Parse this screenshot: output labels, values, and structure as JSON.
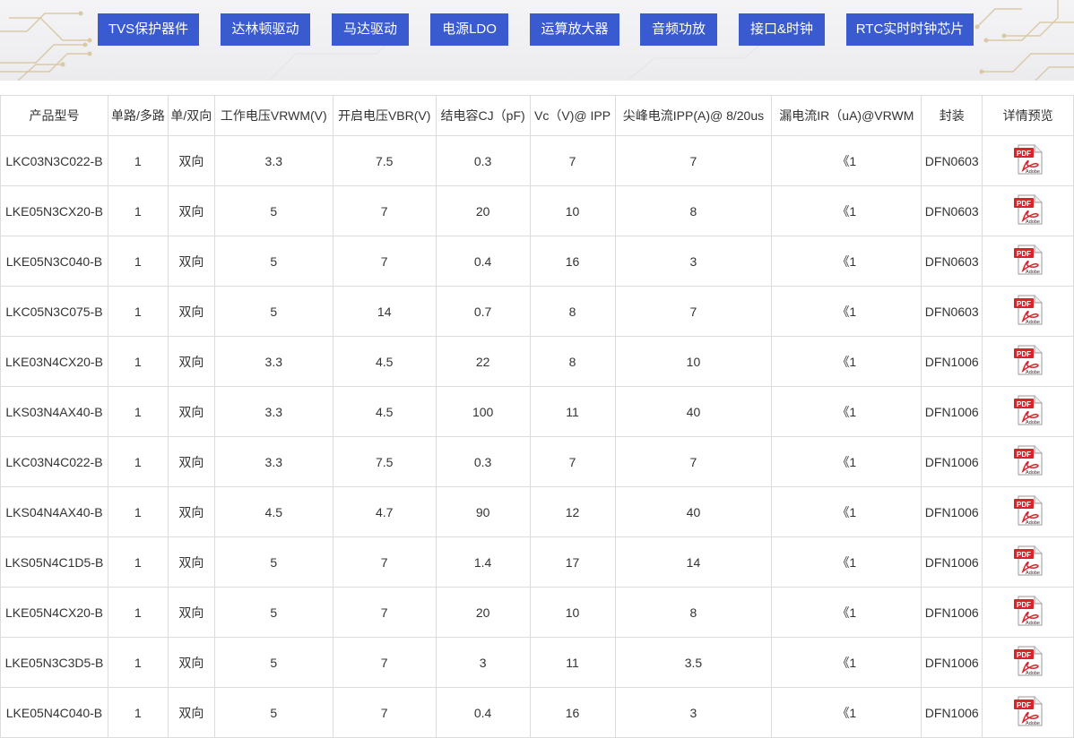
{
  "nav": {
    "categories": [
      "TVS保护器件",
      "达林顿驱动",
      "马达驱动",
      "电源LDO",
      "运算放大器",
      "音频功放",
      "接口&时钟",
      "RTC实时时钟芯片"
    ]
  },
  "table": {
    "headers": [
      "产品型号",
      "单路/多路",
      "单/双向",
      "工作电压VRWM(V)",
      "开启电压VBR(V)",
      "结电容CJ（pF)",
      "Vc（V)@ IPP",
      "尖峰电流IPP(A)@ 8/20us",
      "漏电流IR（uA)@VRWM",
      "封装",
      "详情预览"
    ],
    "rows": [
      [
        "LKC03N3C022-B",
        "1",
        "双向",
        "3.3",
        "7.5",
        "0.3",
        "7",
        "7",
        "《1",
        "DFN0603"
      ],
      [
        "LKE05N3CX20-B",
        "1",
        "双向",
        "5",
        "7",
        "20",
        "10",
        "8",
        "《1",
        "DFN0603"
      ],
      [
        "LKE05N3C040-B",
        "1",
        "双向",
        "5",
        "7",
        "0.4",
        "16",
        "3",
        "《1",
        "DFN0603"
      ],
      [
        "LKC05N3C075-B",
        "1",
        "双向",
        "5",
        "14",
        "0.7",
        "8",
        "7",
        "《1",
        "DFN0603"
      ],
      [
        "LKE03N4CX20-B",
        "1",
        "双向",
        "3.3",
        "4.5",
        "22",
        "8",
        "10",
        "《1",
        "DFN1006"
      ],
      [
        "LKS03N4AX40-B",
        "1",
        "双向",
        "3.3",
        "4.5",
        "100",
        "11",
        "40",
        "《1",
        "DFN1006"
      ],
      [
        "LKC03N4C022-B",
        "1",
        "双向",
        "3.3",
        "7.5",
        "0.3",
        "7",
        "7",
        "《1",
        "DFN1006"
      ],
      [
        "LKS04N4AX40-B",
        "1",
        "双向",
        "4.5",
        "4.7",
        "90",
        "12",
        "40",
        "《1",
        "DFN1006"
      ],
      [
        "LKS05N4C1D5-B",
        "1",
        "双向",
        "5",
        "7",
        "1.4",
        "17",
        "14",
        "《1",
        "DFN1006"
      ],
      [
        "LKE05N4CX20-B",
        "1",
        "双向",
        "5",
        "7",
        "20",
        "10",
        "8",
        "《1",
        "DFN1006"
      ],
      [
        "LKE05N3C3D5-B",
        "1",
        "双向",
        "5",
        "7",
        "3",
        "11",
        "3.5",
        "《1",
        "DFN1006"
      ],
      [
        "LKE05N4C040-B",
        "1",
        "双向",
        "5",
        "7",
        "0.4",
        "16",
        "3",
        "《1",
        "DFN1006"
      ]
    ],
    "preview_icon": "pdf-adobe-icon",
    "preview_icon_labels": {
      "top": "PDF",
      "bottom": "Adobe"
    }
  },
  "colors": {
    "nav_button": "#3a5bcf",
    "pdf_red": "#d6262c"
  }
}
